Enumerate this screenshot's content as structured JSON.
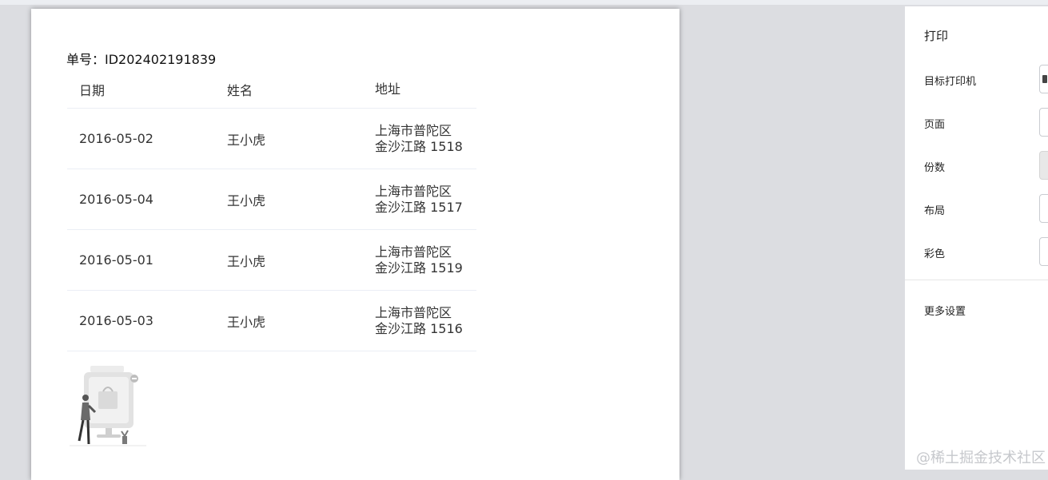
{
  "document": {
    "order_label": "单号：ID202402191839",
    "table": {
      "headers": [
        "日期",
        "姓名",
        "地址"
      ],
      "rows": [
        {
          "date": "2016-05-02",
          "name": "王小虎",
          "address_line1": "上海市普陀区",
          "address_line2": "金沙江路 1518"
        },
        {
          "date": "2016-05-04",
          "name": "王小虎",
          "address_line1": "上海市普陀区",
          "address_line2": "金沙江路 1517"
        },
        {
          "date": "2016-05-01",
          "name": "王小虎",
          "address_line1": "上海市普陀区",
          "address_line2": "金沙江路 1519"
        },
        {
          "date": "2016-05-03",
          "name": "王小虎",
          "address_line1": "上海市普陀区",
          "address_line2": "金沙江路 1516"
        }
      ]
    },
    "illustration": "person-with-shopping-screen-illustration"
  },
  "print_panel": {
    "title": "打印",
    "settings": {
      "printer": "目标打印机",
      "pages": "页面",
      "copies": "份数",
      "layout": "布局",
      "color": "彩色"
    },
    "more_settings": "更多设置"
  },
  "watermark": "@稀土掘金技术社区"
}
